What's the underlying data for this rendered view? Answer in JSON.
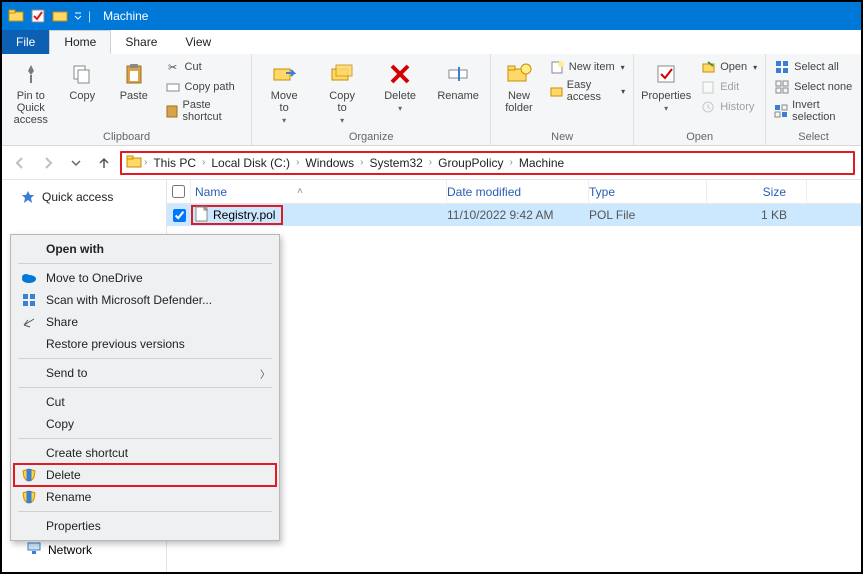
{
  "titlebar": {
    "title": "Machine"
  },
  "tabs": {
    "file": "File",
    "home": "Home",
    "share": "Share",
    "view": "View"
  },
  "ribbon": {
    "pin": "Pin to Quick\naccess",
    "copy": "Copy",
    "paste": "Paste",
    "cut": "Cut",
    "copypath": "Copy path",
    "pastesc": "Paste shortcut",
    "clipboard": "Clipboard",
    "moveto": "Move\nto",
    "copyto": "Copy\nto",
    "delete": "Delete",
    "rename": "Rename",
    "organize": "Organize",
    "newfolder": "New\nfolder",
    "newitem": "New item",
    "easyaccess": "Easy access",
    "new": "New",
    "properties": "Properties",
    "open": "Open",
    "edit": "Edit",
    "history": "History",
    "opengrp": "Open",
    "selectall": "Select all",
    "selectnone": "Select none",
    "invert": "Invert selection",
    "select": "Select"
  },
  "breadcrumbs": [
    "This PC",
    "Local Disk (C:)",
    "Windows",
    "System32",
    "GroupPolicy",
    "Machine"
  ],
  "columns": {
    "name": "Name",
    "date": "Date modified",
    "type": "Type",
    "size": "Size"
  },
  "file": {
    "name": "Registry.pol",
    "date": "11/10/2022 9:42 AM",
    "type": "POL File",
    "size": "1 KB"
  },
  "sidebar": {
    "quickaccess": "Quick access",
    "network": "Network"
  },
  "context": {
    "openwith": "Open with",
    "onedrive": "Move to OneDrive",
    "defender": "Scan with Microsoft Defender...",
    "share": "Share",
    "restore": "Restore previous versions",
    "sendto": "Send to",
    "cut": "Cut",
    "copy": "Copy",
    "createsc": "Create shortcut",
    "delete": "Delete",
    "rename": "Rename",
    "properties": "Properties"
  }
}
